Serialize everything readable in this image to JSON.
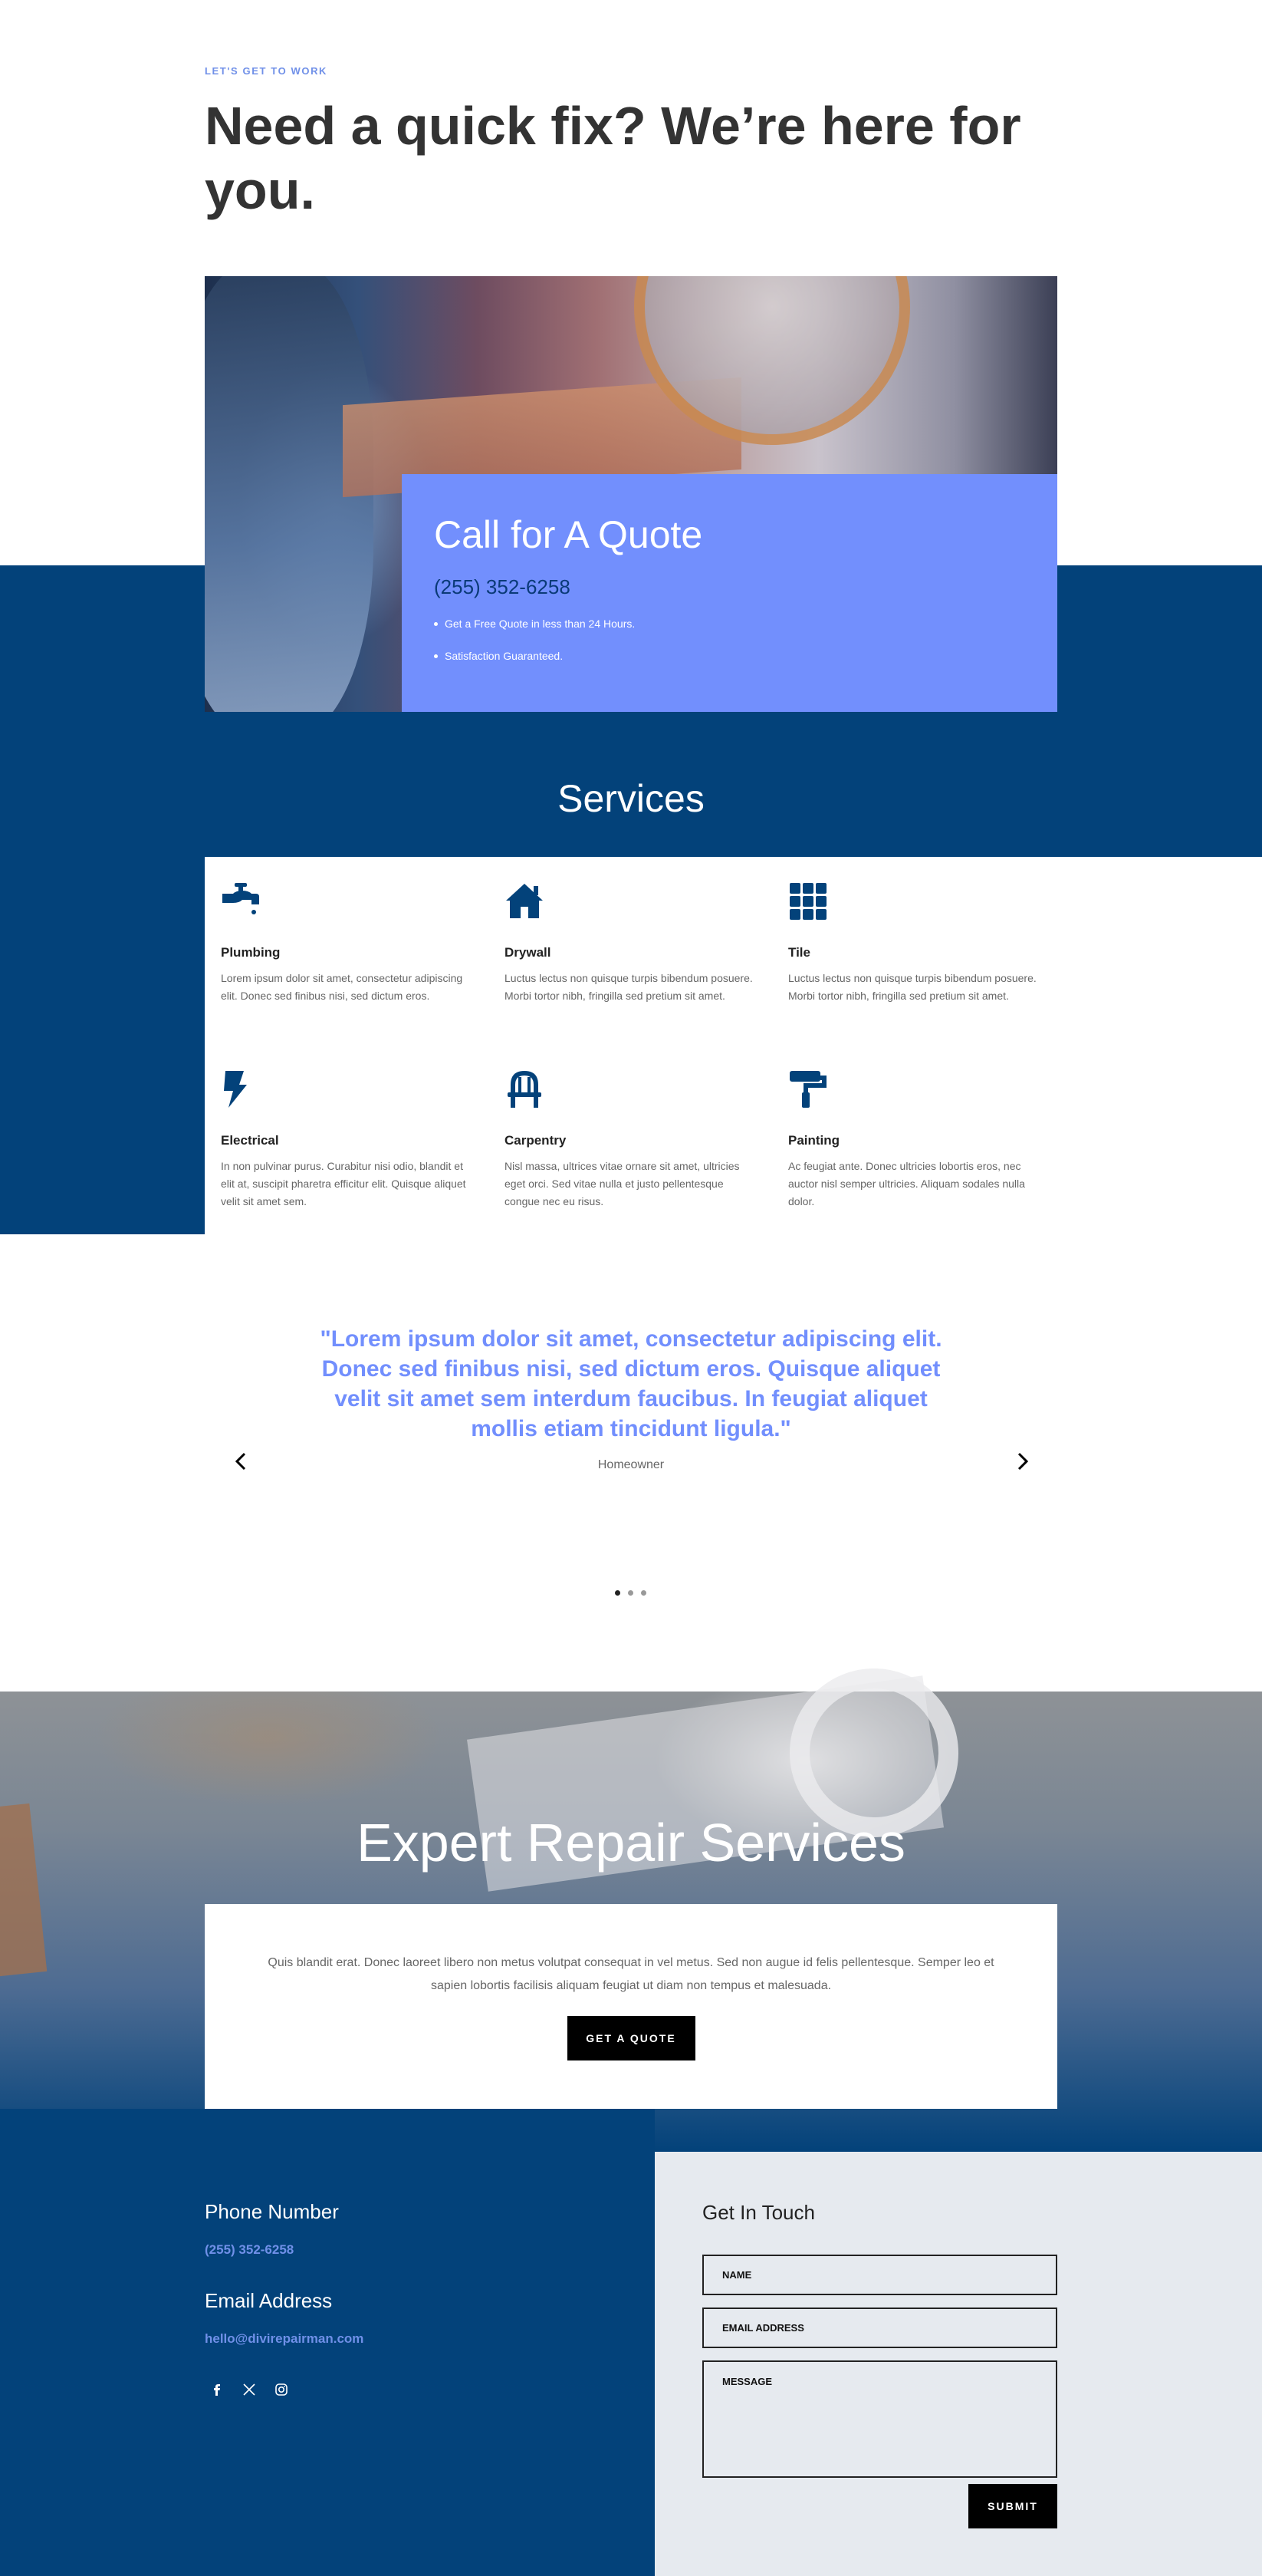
{
  "hero": {
    "eyebrow": "LET'S GET TO WORK",
    "title": "Need a quick fix? We’re here for you."
  },
  "quote_card": {
    "title": "Call for A Quote",
    "phone": "(255) 352-6258",
    "bullets": [
      "Get a Free Quote in less than 24 Hours.",
      "Satisfaction Guaranteed."
    ]
  },
  "services": {
    "title": "Services",
    "items": [
      {
        "icon": "faucet-icon",
        "name": "Plumbing",
        "text": "Lorem ipsum dolor sit amet, consectetur adipiscing elit. Donec sed finibus nisi, sed dictum eros."
      },
      {
        "icon": "home-icon",
        "name": "Drywall",
        "text": "Luctus lectus non quisque turpis bibendum posuere. Morbi tortor nibh, fringilla sed pretium sit amet."
      },
      {
        "icon": "grid-icon",
        "name": "Tile",
        "text": "Luctus lectus non quisque turpis bibendum posuere. Morbi tortor nibh, fringilla sed pretium sit amet."
      },
      {
        "icon": "lightning-icon",
        "name": "Electrical",
        "text": "In non pulvinar purus. Curabitur nisi odio, blandit et elit at, suscipit pharetra efficitur elit. Quisque aliquet velit sit amet sem."
      },
      {
        "icon": "chair-icon",
        "name": "Carpentry",
        "text": "Nisl massa, ultrices vitae ornare sit amet, ultricies eget orci. Sed vitae nulla et justo pellentesque congue nec eu risus."
      },
      {
        "icon": "paint-roller-icon",
        "name": "Painting",
        "text": "Ac feugiat ante. Donec ultricies lobortis eros, nec auctor nisl semper ultricies. Aliquam sodales nulla dolor."
      }
    ]
  },
  "testimonial": {
    "quote": "\"Lorem ipsum dolor sit amet, consectetur adipiscing elit. Donec sed finibus nisi, sed dictum eros. Quisque aliquet velit sit amet sem interdum faucibus. In feugiat aliquet mollis etiam tincidunt ligula.\"",
    "role": "Homeowner",
    "slides": 3,
    "active_slide": 1
  },
  "expert": {
    "title": "Expert Repair Services",
    "text": "Quis blandit erat. Donec laoreet libero non metus volutpat consequat in vel metus. Sed non augue id felis pellentesque. Semper leo et sapien lobortis facilisis aliquam feugiat ut diam non tempus et malesuada.",
    "button": "GET A QUOTE"
  },
  "contact": {
    "phone_label": "Phone Number",
    "phone": "(255) 352-6258",
    "email_label": "Email Address",
    "email": "hello@divirepairman.com",
    "social": [
      "facebook-icon",
      "x-icon",
      "instagram-icon"
    ]
  },
  "form": {
    "title": "Get In Touch",
    "name_placeholder": "NAME",
    "email_placeholder": "EMAIL ADDRESS",
    "message_placeholder": "MESSAGE",
    "submit": "SUBMIT"
  },
  "colors": {
    "navy": "#03427a",
    "accent": "#728ffd",
    "light_gray": "#e6eaef"
  }
}
